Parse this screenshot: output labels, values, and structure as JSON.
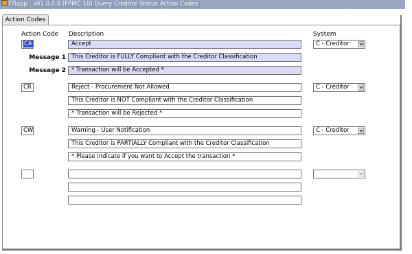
{
  "window": {
    "title": "f7iapp : v01.0.0.0 (FPMC-10) Query Creditor Status Action Codes"
  },
  "tabs": [
    {
      "label": "Action Codes"
    }
  ],
  "headers": {
    "action_code": "Action Code",
    "description": "Description",
    "system": "System"
  },
  "labels": {
    "message1": "Message 1",
    "message2": "Message 2"
  },
  "rows": [
    {
      "code": "CA",
      "description": "Accept",
      "message1": "This Creditor is FULLY Compliant with the Creditor Classification",
      "message2": "* Transaction will be Accepted *",
      "system": "C - Creditor"
    },
    {
      "code": "CR",
      "description": "Reject - Procurement Not Allowed",
      "message1": "This Creditor is NOT Compliant with the Creditor Classification",
      "message2": "* Transaction will be Rejected *",
      "system": "C - Creditor"
    },
    {
      "code": "CW",
      "description": "Warning - User Notification",
      "message1": "This Creditor is PARTIALLY Compliant with the Creditor Classification",
      "message2": "* Please indicate if you want to Accept the transaction *",
      "system": "C - Creditor"
    },
    {
      "code": "",
      "description": "",
      "message1": "",
      "message2": "",
      "system": ""
    }
  ],
  "colors": {
    "selection": "#2b4dc8",
    "current_record": "#d8dcf6",
    "titlebar": "#8a9ab8"
  },
  "icons": {
    "window_icon": "app-icon",
    "combo_arrow": "chevron-down-icon"
  }
}
